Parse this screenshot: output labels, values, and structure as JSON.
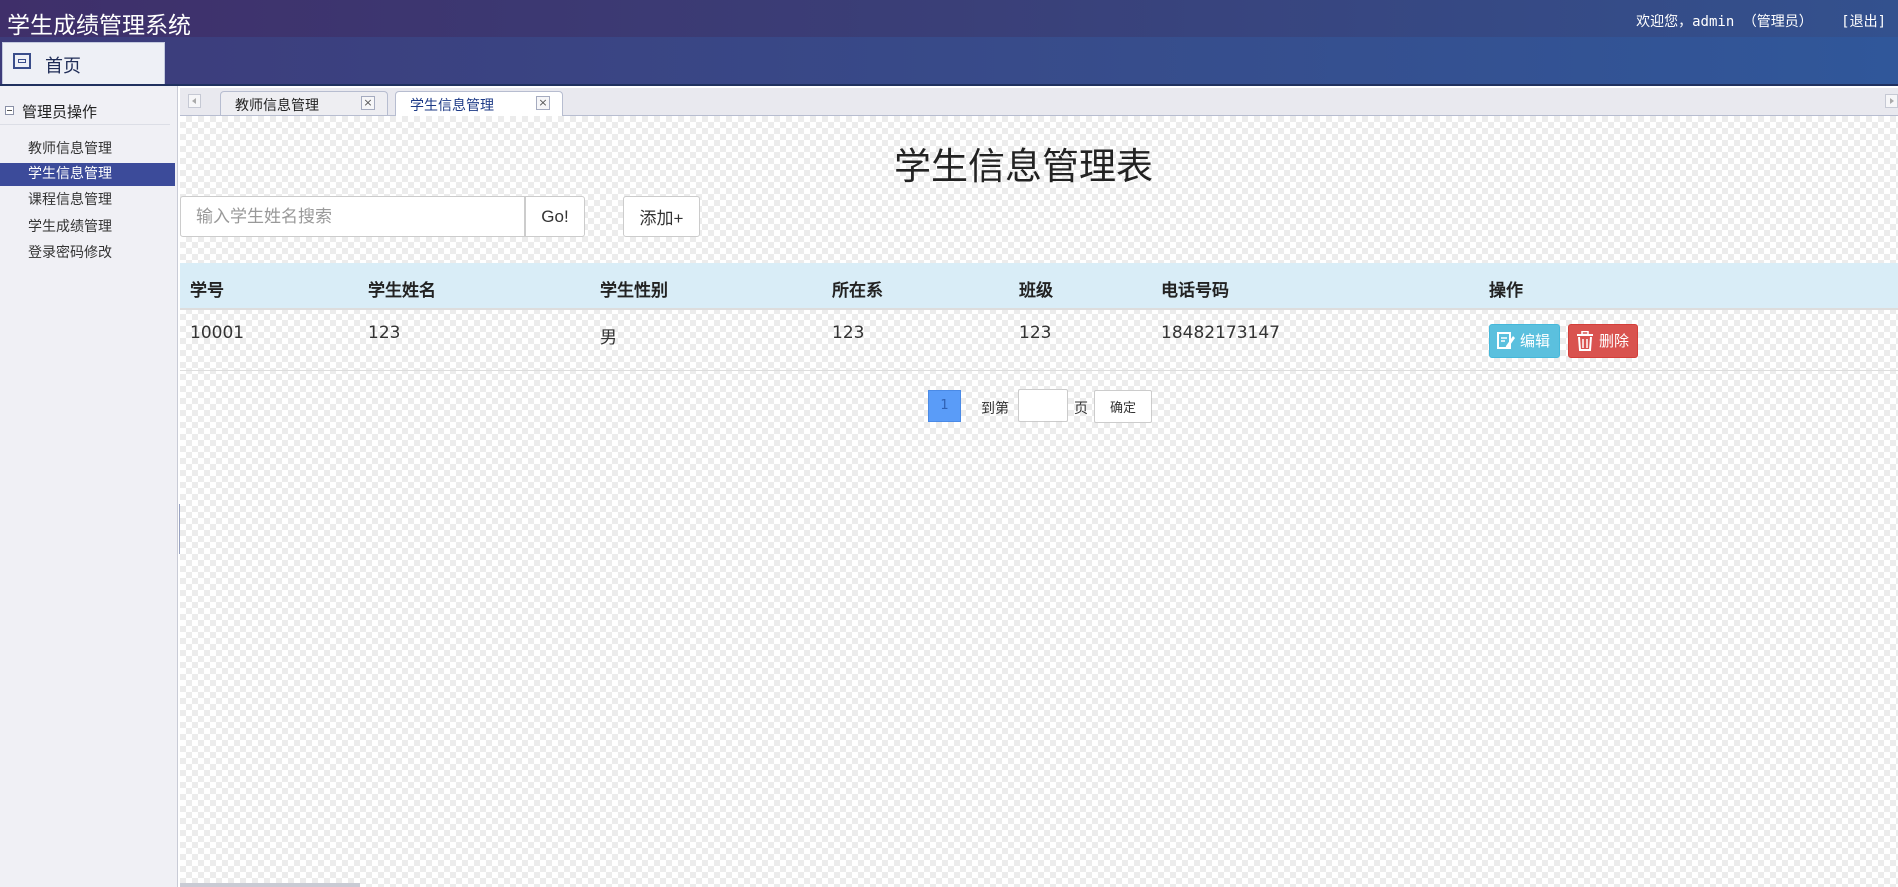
{
  "header": {
    "app_title": "学生成绩管理系统",
    "welcome_text": "欢迎您，admin （管理员）",
    "logout_label": "[退出]"
  },
  "nav": {
    "home_label": "首页",
    "home_icon": "window-icon"
  },
  "sidebar": {
    "section_title": "管理员操作",
    "items": [
      {
        "label": "教师信息管理",
        "active": false
      },
      {
        "label": "学生信息管理",
        "active": true
      },
      {
        "label": "课程信息管理",
        "active": false
      },
      {
        "label": "学生成绩管理",
        "active": false
      },
      {
        "label": "登录密码修改",
        "active": false
      }
    ]
  },
  "tabs": [
    {
      "label": "教师信息管理",
      "active": false,
      "close": "×"
    },
    {
      "label": "学生信息管理",
      "active": true,
      "close": "×"
    }
  ],
  "main": {
    "page_title": "学生信息管理表",
    "search": {
      "placeholder": "输入学生姓名搜索",
      "value": ""
    },
    "go_label": "Go!",
    "add_label": "添加+",
    "table": {
      "columns": [
        "学号",
        "学生姓名",
        "学生性别",
        "所在系",
        "班级",
        "电话号码",
        "操作"
      ],
      "rows": [
        {
          "cells": [
            "10001",
            "123",
            "男",
            "123",
            "123",
            "18482173147"
          ],
          "edit_label": "编辑",
          "delete_label": "删除"
        }
      ]
    },
    "pager": {
      "current_page": "1",
      "goto_label": "到第",
      "page_label": "页",
      "confirm_label": "确定"
    }
  },
  "colors": {
    "header_start": "#3f2f6a",
    "header_end": "#33518e",
    "sidebar_active": "#3c4b9a",
    "table_header_bg": "#d9edf7",
    "edit_button": "#5bc0de",
    "delete_button": "#d9534f",
    "pager_active": "#5a9cf8"
  }
}
